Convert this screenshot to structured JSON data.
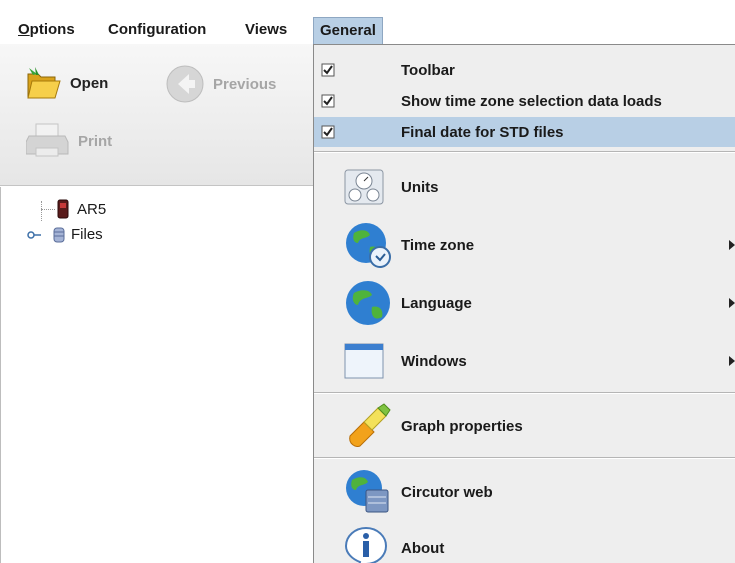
{
  "menubar": {
    "items": [
      "Options",
      "Configuration",
      "Views",
      "General"
    ]
  },
  "toolbar": {
    "open_label": "Open",
    "previous_label": "Previous",
    "print_label": "Print"
  },
  "tree": {
    "items": [
      "AR5",
      "Files"
    ]
  },
  "general_menu": {
    "checkable": [
      {
        "label": "Toolbar",
        "checked": true
      },
      {
        "label": "Show time zone selection data loads",
        "checked": true
      },
      {
        "label": "Final date for STD files",
        "checked": true
      }
    ],
    "units": "Units",
    "time_zone": "Time zone",
    "language": "Language",
    "windows": "Windows",
    "graph_properties": "Graph properties",
    "circutor_web": "Circutor web",
    "about": "About"
  },
  "colors": {
    "highlight": "#b8cfe5",
    "menu_bg": "#eeeeee",
    "toolbar_bg": "#ececec"
  }
}
